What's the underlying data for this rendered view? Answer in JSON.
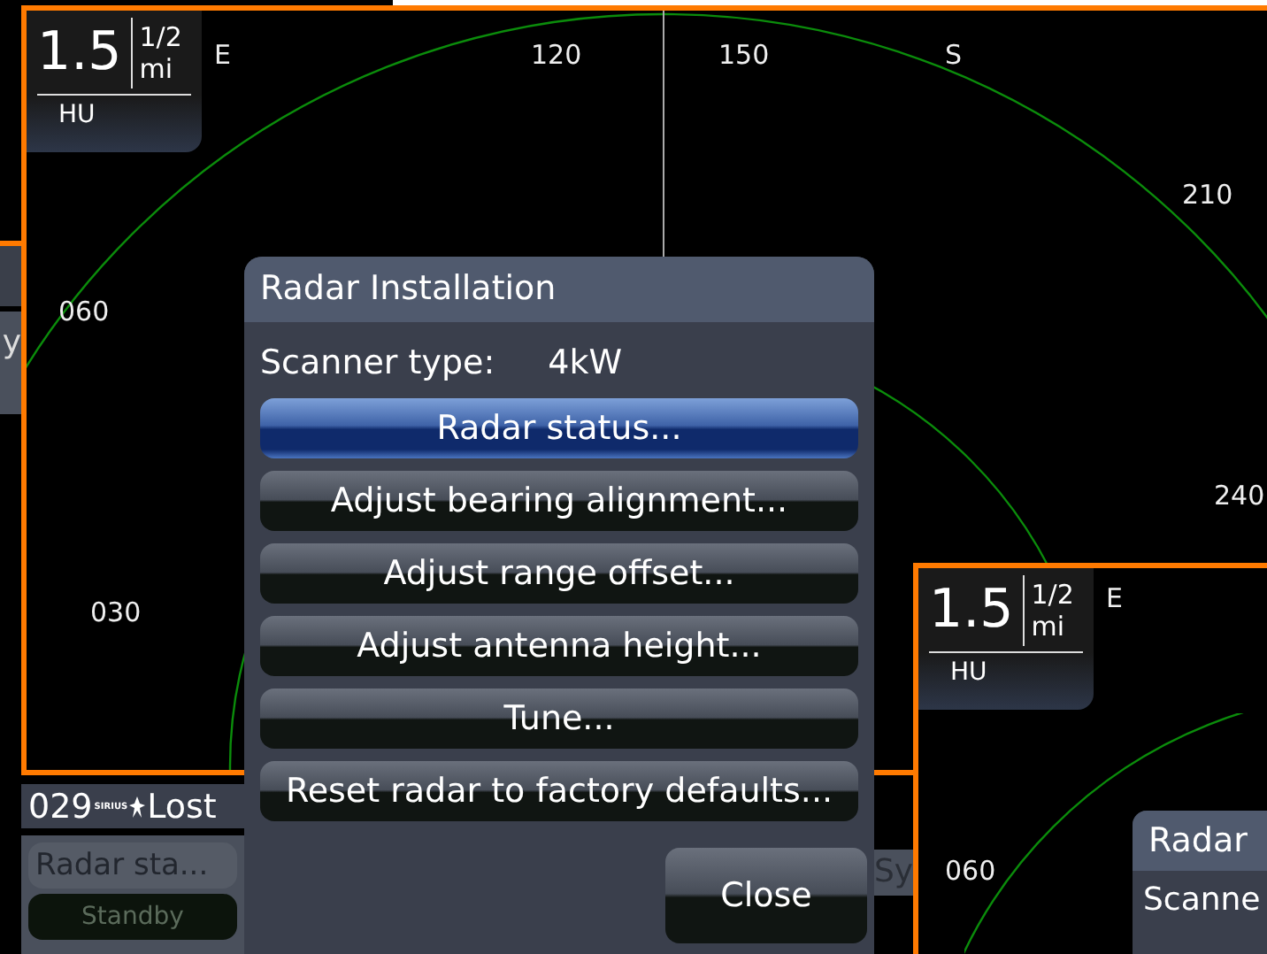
{
  "left_pane": {
    "button_fragment": "y"
  },
  "main_radar": {
    "range": {
      "value": "1.5",
      "fraction": "1/2",
      "unit": "mi"
    },
    "orientation": "HU",
    "heading_label": "E",
    "bearing_labels": [
      "120",
      "150",
      "S",
      "210",
      "240",
      "060",
      "030"
    ]
  },
  "data_bar": {
    "channel": "029",
    "logo_text": "SIRIUS",
    "status": "Lost"
  },
  "bottom_buttons": [
    {
      "label": "Radar sta...",
      "kind": "normal"
    },
    {
      "label": "Standby",
      "kind": "dim"
    }
  ],
  "dialog": {
    "title": "Radar Installation",
    "scanner_label": "Scanner type:",
    "scanner_value": "4kW",
    "buttons": [
      {
        "label": "Radar status...",
        "selected": true
      },
      {
        "label": "Adjust bearing alignment...",
        "selected": false
      },
      {
        "label": "Adjust range offset...",
        "selected": false
      },
      {
        "label": "Adjust antenna height...",
        "selected": false
      },
      {
        "label": "Tune...",
        "selected": false
      },
      {
        "label": "Reset radar to factory defaults...",
        "selected": false
      }
    ],
    "close": "Close"
  },
  "middle_button_fragment": "Sy",
  "second_radar": {
    "range": {
      "value": "1.5",
      "fraction": "1/2",
      "unit": "mi"
    },
    "orientation": "HU",
    "heading_label": "E",
    "bearing_labels": [
      "060"
    ],
    "dialog": {
      "title": "Radar",
      "scanner_label": "Scanne"
    }
  }
}
